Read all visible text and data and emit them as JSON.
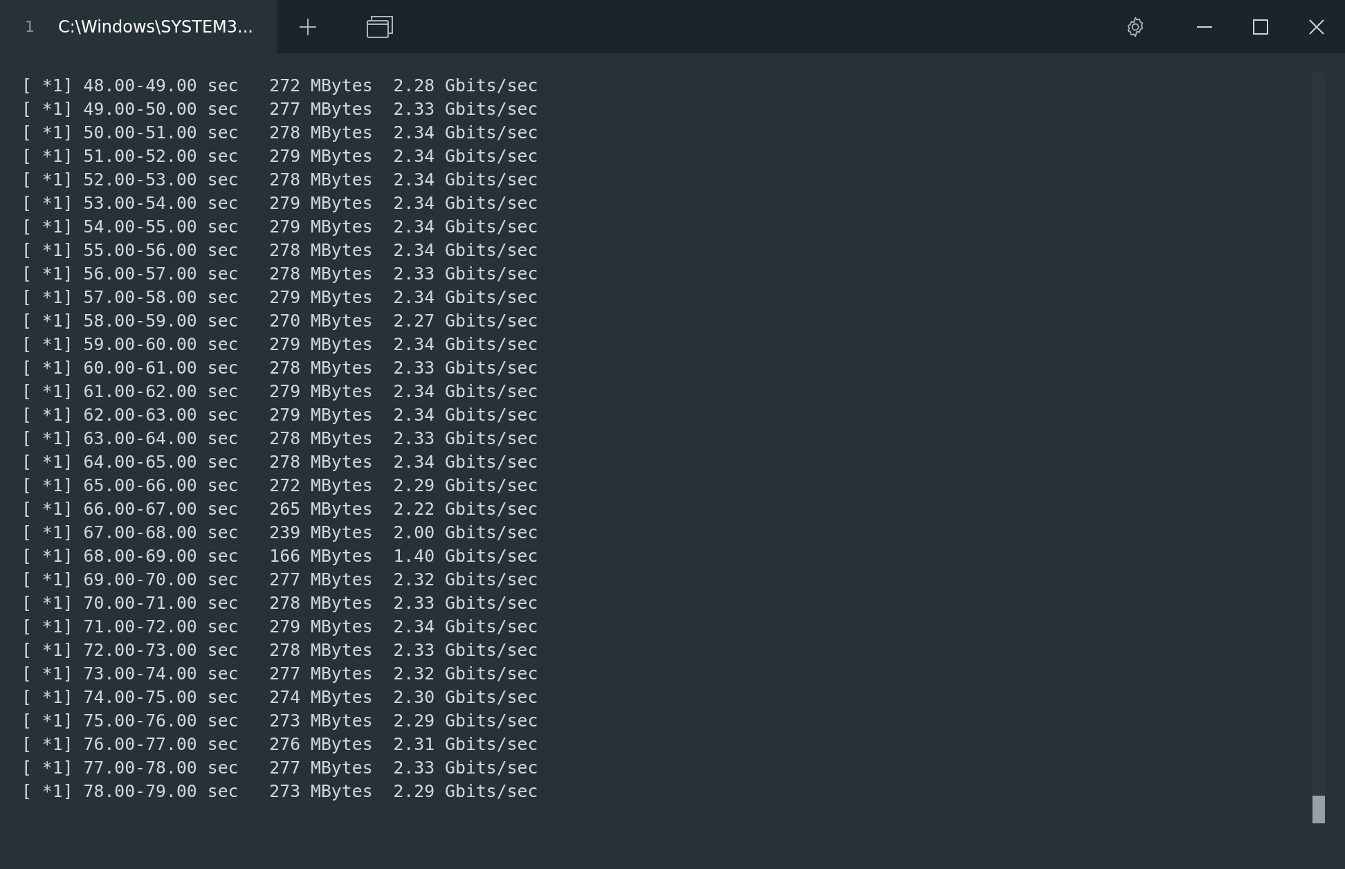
{
  "tabs": [
    {
      "number": "1",
      "title": "C:\\Windows\\SYSTEM3...",
      "selected": true
    }
  ],
  "terminal": {
    "lines": [
      "[ *1] 48.00-49.00 sec   272 MBytes  2.28 Gbits/sec",
      "[ *1] 49.00-50.00 sec   277 MBytes  2.33 Gbits/sec",
      "[ *1] 50.00-51.00 sec   278 MBytes  2.34 Gbits/sec",
      "[ *1] 51.00-52.00 sec   279 MBytes  2.34 Gbits/sec",
      "[ *1] 52.00-53.00 sec   278 MBytes  2.34 Gbits/sec",
      "[ *1] 53.00-54.00 sec   279 MBytes  2.34 Gbits/sec",
      "[ *1] 54.00-55.00 sec   279 MBytes  2.34 Gbits/sec",
      "[ *1] 55.00-56.00 sec   278 MBytes  2.34 Gbits/sec",
      "[ *1] 56.00-57.00 sec   278 MBytes  2.33 Gbits/sec",
      "[ *1] 57.00-58.00 sec   279 MBytes  2.34 Gbits/sec",
      "[ *1] 58.00-59.00 sec   270 MBytes  2.27 Gbits/sec",
      "[ *1] 59.00-60.00 sec   279 MBytes  2.34 Gbits/sec",
      "[ *1] 60.00-61.00 sec   278 MBytes  2.33 Gbits/sec",
      "[ *1] 61.00-62.00 sec   279 MBytes  2.34 Gbits/sec",
      "[ *1] 62.00-63.00 sec   279 MBytes  2.34 Gbits/sec",
      "[ *1] 63.00-64.00 sec   278 MBytes  2.33 Gbits/sec",
      "[ *1] 64.00-65.00 sec   278 MBytes  2.34 Gbits/sec",
      "[ *1] 65.00-66.00 sec   272 MBytes  2.29 Gbits/sec",
      "[ *1] 66.00-67.00 sec   265 MBytes  2.22 Gbits/sec",
      "[ *1] 67.00-68.00 sec   239 MBytes  2.00 Gbits/sec",
      "[ *1] 68.00-69.00 sec   166 MBytes  1.40 Gbits/sec",
      "[ *1] 69.00-70.00 sec   277 MBytes  2.32 Gbits/sec",
      "[ *1] 70.00-71.00 sec   278 MBytes  2.33 Gbits/sec",
      "[ *1] 71.00-72.00 sec   279 MBytes  2.34 Gbits/sec",
      "[ *1] 72.00-73.00 sec   278 MBytes  2.33 Gbits/sec",
      "[ *1] 73.00-74.00 sec   277 MBytes  2.32 Gbits/sec",
      "[ *1] 74.00-75.00 sec   274 MBytes  2.30 Gbits/sec",
      "[ *1] 75.00-76.00 sec   273 MBytes  2.29 Gbits/sec",
      "[ *1] 76.00-77.00 sec   276 MBytes  2.31 Gbits/sec",
      "[ *1] 77.00-78.00 sec   277 MBytes  2.33 Gbits/sec",
      "[ *1] 78.00-79.00 sec   273 MBytes  2.29 Gbits/sec"
    ]
  }
}
